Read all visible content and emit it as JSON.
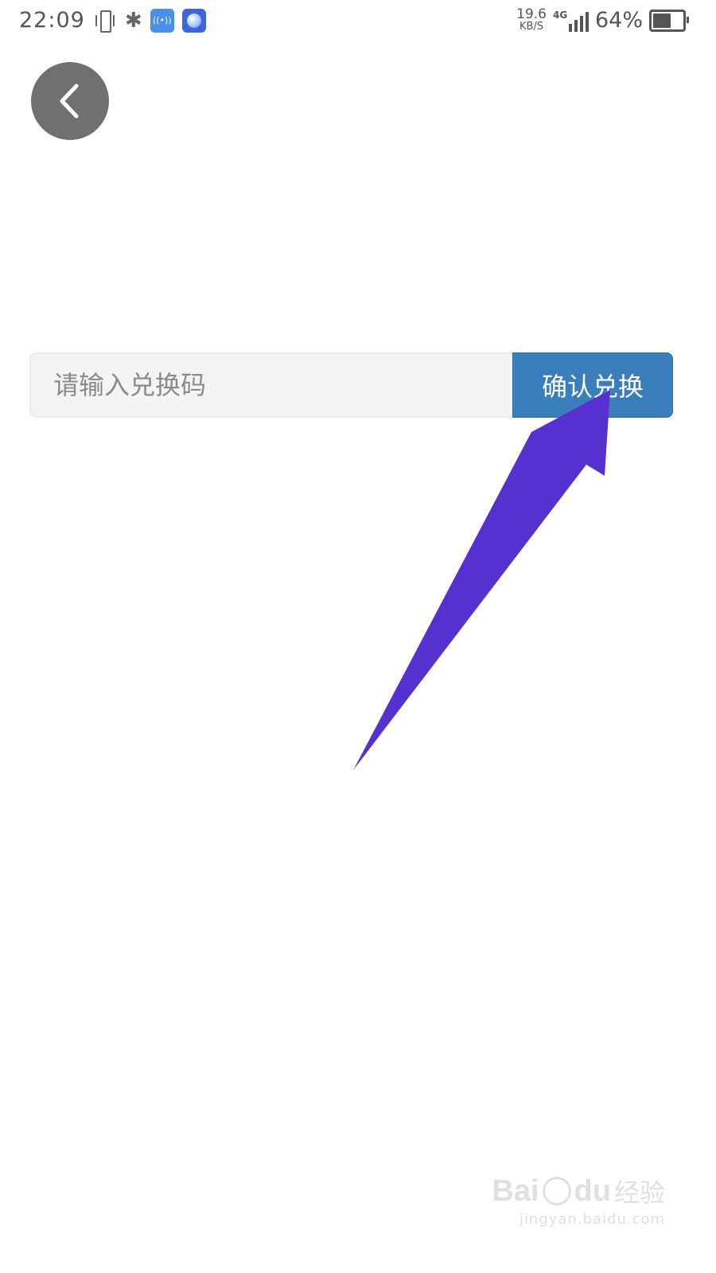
{
  "status_bar": {
    "time": "22:09",
    "net_speed_value": "19.6",
    "net_speed_unit": "KB/S",
    "network_type": "4G",
    "battery_percent": "64%",
    "battery_level": 0.64,
    "icons": [
      "vibrate-icon",
      "bluetooth-icon",
      "hotspot-icon",
      "app-notification-icon",
      "signal-icon",
      "battery-icon"
    ]
  },
  "back_button": {
    "icon": "chevron-left-icon"
  },
  "redeem": {
    "placeholder": "请输入兑换码",
    "value": "",
    "confirm_label": "确认兑换"
  },
  "annotation": {
    "color": "#5631cf"
  },
  "watermark": {
    "brand": "Bai",
    "brand_suffix": "du",
    "cn": "经验",
    "url": "jingyan.baidu.com"
  },
  "colors": {
    "button_blue": "#3a7ebb",
    "back_button_gray": "#707070",
    "input_bg": "#f4f4f4"
  }
}
